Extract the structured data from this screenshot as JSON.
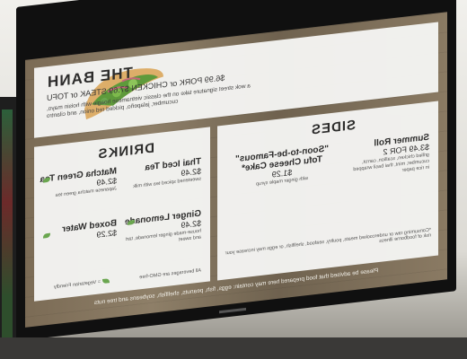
{
  "banh": {
    "title": "THE BANH",
    "price": "$6.99 PORK or CHICKEN $7.69 STEAK or TOFU",
    "desc": "a wok street signature take on the classic vietnamese hoagie with hoisin mayo, cucumber, jalapeño, pickled red onion, and cilantro"
  },
  "drinks": {
    "title": "DRINKS",
    "items": [
      {
        "name": "Thai Iced Tea",
        "price": "$2.49",
        "desc": "sweetened spiced tea with milk"
      },
      {
        "name": "Matcha Green Tea",
        "price": "$2.49",
        "desc": "Japanese matcha green tea"
      },
      {
        "name": "Ginger Lemonade",
        "price": "$2.49",
        "desc": "house-made ginger lemonade, tart and sweet"
      },
      {
        "name": "Boxed Water",
        "price": "$2.29",
        "desc": ""
      }
    ],
    "vegan_note": "All beverages are GMO-free",
    "vegetarian_label": "= Vegetarian Friendly"
  },
  "sides": {
    "title": "SIDES",
    "items": [
      {
        "name": "Summer Roll",
        "price": "$3.49 FOR 2",
        "desc": "grilled chicken, scallion, carrot, cucumber, mint, thai basil wrapped in rice paper"
      },
      {
        "name": "\"Soon-to-be-Famous\" Tofu Cheese Cake*",
        "price": "$1.29",
        "desc": "with ginger maple syrup"
      }
    ],
    "disclaimer": "*Consuming raw or undercooked meats, poultry, seafood, shellfish, or eggs may increase your risk of foodborne illness"
  },
  "footer": "Please be advised that food prepared here may contain: eggs, fish, peanuts, shellfish, soybeans and tree nuts"
}
